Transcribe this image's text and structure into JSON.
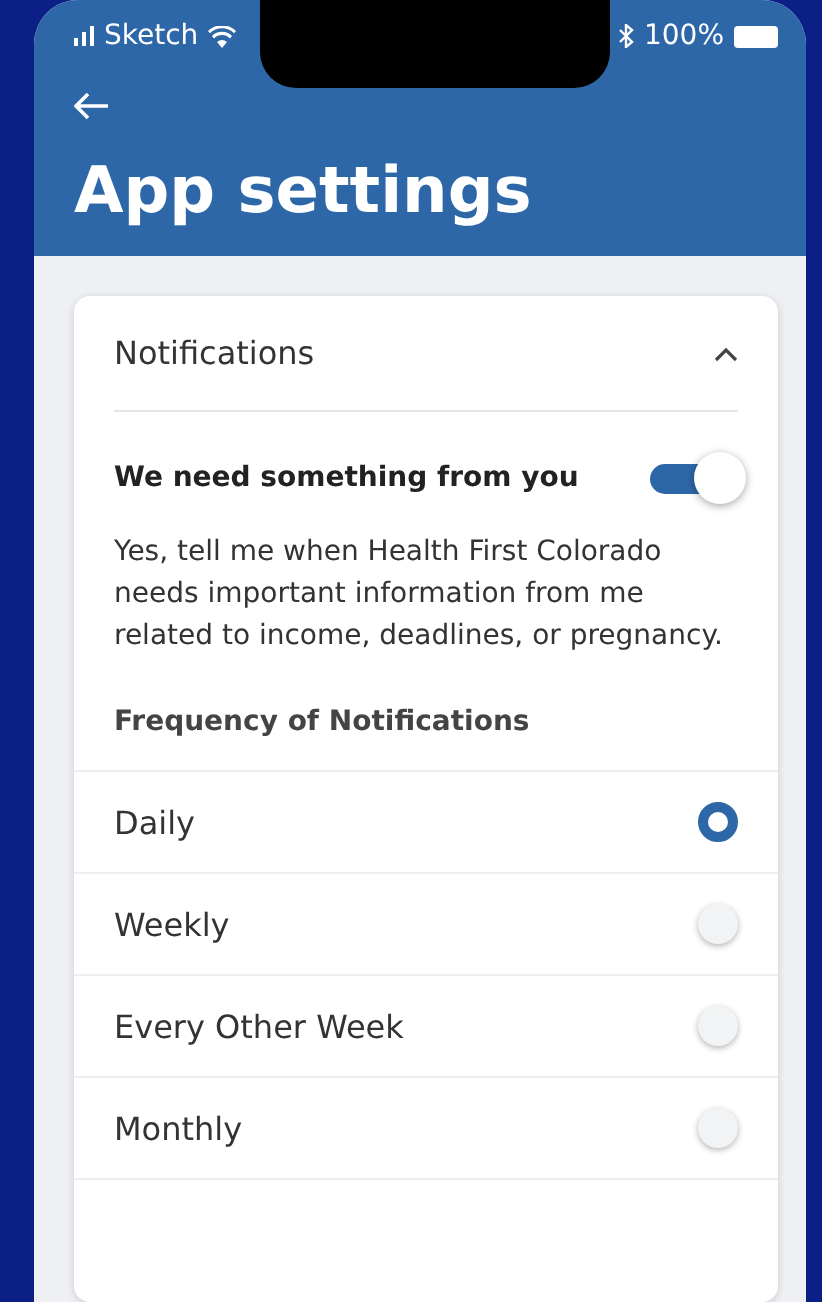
{
  "status_bar": {
    "carrier": "Sketch",
    "battery": "100%"
  },
  "header": {
    "title": "App settings"
  },
  "section": {
    "title": "Notifications",
    "expanded": true,
    "toggle": {
      "label": "We need something from you",
      "on": true
    },
    "description": "Yes, tell me when Health First Colorado needs important information from me related to income, deadlines, or pregnancy.",
    "frequency_label": "Frequency of Notifications",
    "options": [
      {
        "label": "Daily",
        "selected": true
      },
      {
        "label": "Weekly",
        "selected": false
      },
      {
        "label": "Every Other Week",
        "selected": false
      },
      {
        "label": "Monthly",
        "selected": false
      }
    ]
  }
}
